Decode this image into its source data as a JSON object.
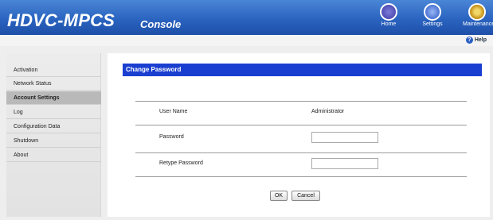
{
  "header": {
    "brand": "HDVC-MPCS",
    "subtitle": "Console",
    "toolbar": [
      {
        "label": "Home",
        "icon": "home-icon"
      },
      {
        "label": "Settings",
        "icon": "settings-icon"
      },
      {
        "label": "Maintenance",
        "icon": "maintenance-icon"
      }
    ],
    "help_label": "Help"
  },
  "sidebar": {
    "items": [
      {
        "label": "Activation",
        "active": false
      },
      {
        "label": "Network Status",
        "active": false
      },
      {
        "label": "Account Settings",
        "active": true
      },
      {
        "label": "Log",
        "active": false
      },
      {
        "label": "Configuration Data",
        "active": false
      },
      {
        "label": "Shutdown",
        "active": false
      },
      {
        "label": "About",
        "active": false
      }
    ]
  },
  "main": {
    "title": "Change Password",
    "user_name_label": "User Name",
    "user_name_value": "Administrator",
    "password_label": "Password",
    "password_value": "",
    "retype_label": "Retype Password",
    "retype_value": "",
    "ok_label": "OK",
    "cancel_label": "Cancel"
  },
  "colors": {
    "header": "#2a64c0",
    "title_bar": "#1a3fd0",
    "active_item": "#b9b9b9"
  }
}
